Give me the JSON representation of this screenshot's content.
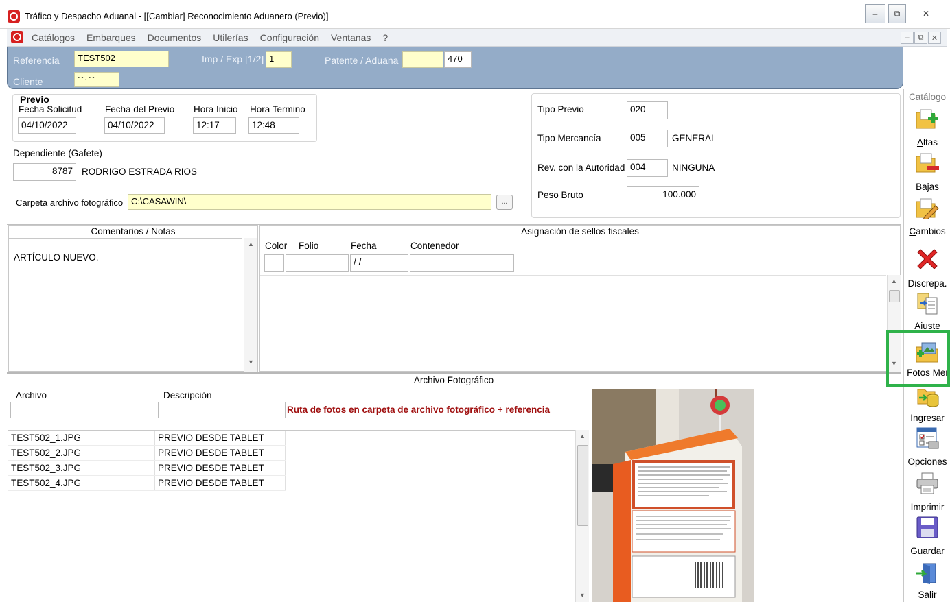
{
  "window": {
    "title": "Tráfico y Despacho Aduanal - [[Cambiar] Reconocimiento Aduanero (Previo)]",
    "controls": {
      "minimize": "–",
      "restore": "⧉",
      "close": "✕"
    }
  },
  "menu": {
    "items": [
      "Catálogos",
      "Embarques",
      "Documentos",
      "Utilerías",
      "Configuración",
      "Ventanas",
      "?"
    ],
    "mdi_controls": {
      "minimize": "–",
      "restore": "⧉",
      "close": "✕"
    }
  },
  "header": {
    "referencia_label": "Referencia",
    "referencia_value": "TEST502",
    "impexp_label": "Imp / Exp [1/2]",
    "impexp_value": "1",
    "patente_label": "Patente / Aduana",
    "patente_value": "",
    "aduana_value": "470",
    "cliente_label": "Cliente",
    "cliente_value": "- - . - -"
  },
  "previo": {
    "group_title": "Previo",
    "fecha_solicitud_label": "Fecha Solicitud",
    "fecha_solicitud_value": "04/10/2022",
    "fecha_previo_label": "Fecha del Previo",
    "fecha_previo_value": "04/10/2022",
    "hora_inicio_label": "Hora Inicio",
    "hora_inicio_value": "12:17",
    "hora_termino_label": "Hora Termino",
    "hora_termino_value": "12:48",
    "dependiente_label": "Dependiente (Gafete)",
    "dependiente_id": "8787",
    "dependiente_name": "RODRIGO ESTRADA RIOS",
    "carpeta_label": "Carpeta archivo fotográfico",
    "carpeta_value": "C:\\CASAWIN\\",
    "browse_label": "..."
  },
  "tipo": {
    "tipo_previo_label": "Tipo Previo",
    "tipo_previo_value": "020",
    "tipo_mercancia_label": "Tipo Mercancía",
    "tipo_mercancia_value": "005",
    "tipo_mercancia_desc": "GENERAL",
    "rev_label": "Rev. con la Autoridad",
    "rev_value": "004",
    "rev_desc": "NINGUNA",
    "peso_label": "Peso Bruto",
    "peso_value": "100.000"
  },
  "comentarios": {
    "title": "Comentarios / Notas",
    "text": "ARTÍCULO NUEVO."
  },
  "sellos": {
    "title": "Asignación de sellos fiscales",
    "col_color": "Color",
    "col_folio": "Folio",
    "col_fecha": "Fecha",
    "col_contenedor": "Contenedor",
    "fecha_placeholder": " / /"
  },
  "fotos": {
    "title": "Archivo Fotográfico",
    "col_archivo": "Archivo",
    "col_descripcion": "Descripción",
    "note": "Ruta de fotos en carpeta de archivo fotográfico + referencia",
    "rows": [
      {
        "archivo": "TEST502_1.JPG",
        "descripcion": "PREVIO DESDE TABLET"
      },
      {
        "archivo": "TEST502_2.JPG",
        "descripcion": "PREVIO DESDE TABLET"
      },
      {
        "archivo": "TEST502_3.JPG",
        "descripcion": "PREVIO DESDE TABLET"
      },
      {
        "archivo": "TEST502_4.JPG",
        "descripcion": "PREVIO DESDE TABLET"
      }
    ]
  },
  "toolbar": {
    "catalogo": "Catálogo",
    "altas": "Altas",
    "bajas": "Bajas",
    "cambios": "Cambios",
    "discrepa": "Discrepa.",
    "ajuste": "Ajuste",
    "fotos": "Fotos Mer.",
    "ingresar": "Ingresar",
    "opciones": "Opciones",
    "imprimir": "Imprimir",
    "guardar": "Guardar",
    "salir": "Salir"
  },
  "colors": {
    "header_blue": "#94acc8",
    "field_yellow": "#ffffcc",
    "note_red": "#a01010",
    "highlight_green": "#2fb24a"
  }
}
